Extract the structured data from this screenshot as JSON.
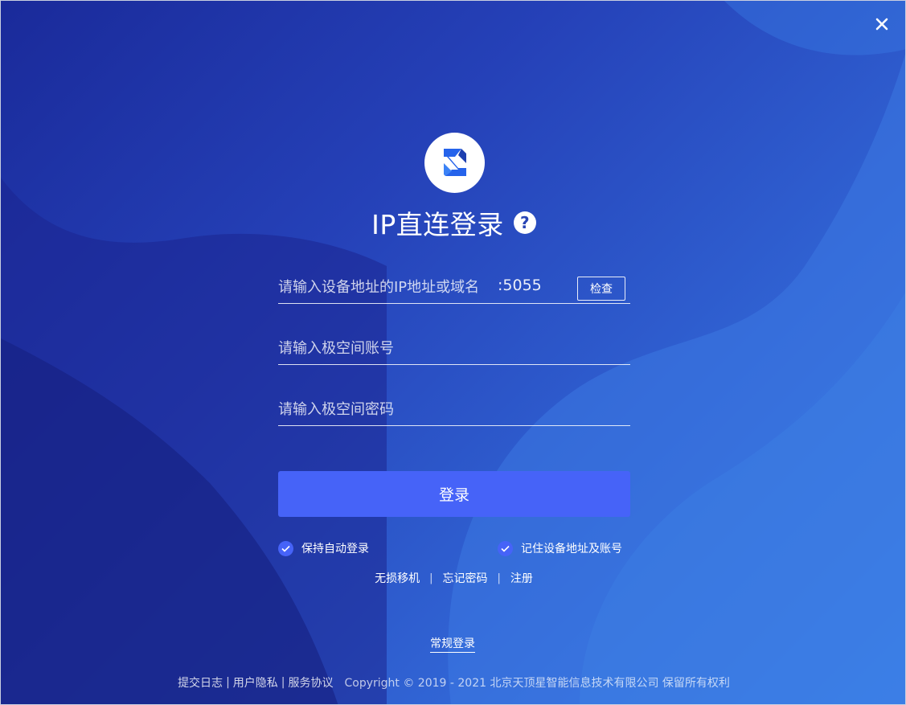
{
  "window": {
    "close_icon": "close-icon"
  },
  "header": {
    "logo_icon": "app-logo-icon",
    "title": "IP直连登录",
    "help_label": "?"
  },
  "form": {
    "address_placeholder": "请输入设备地址的IP地址或域名",
    "address_value": "",
    "port_label": ":5055",
    "check_button_label": "检查",
    "account_placeholder": "请输入极空间账号",
    "account_value": "",
    "password_placeholder": "请输入极空间密码",
    "password_value": "",
    "login_button_label": "登录"
  },
  "options": {
    "auto_login_label": "保持自动登录",
    "auto_login_checked": true,
    "remember_label": "记住设备地址及账号",
    "remember_checked": true
  },
  "links": {
    "migrate_label": "无损移机",
    "forgot_label": "忘记密码",
    "register_label": "注册",
    "separator": "|"
  },
  "normal_login_label": "常规登录",
  "footer": {
    "log_label": "提交日志",
    "privacy_label": "用户隐私",
    "terms_label": "服务协议",
    "separator": "|",
    "copyright": "Copyright © 2019 - 2021 北京天顶星智能信息技术有限公司 保留所有权利"
  },
  "colors": {
    "background_start": "#1a2a9a",
    "background_end": "#3a82ec",
    "accent": "#4663f8"
  }
}
